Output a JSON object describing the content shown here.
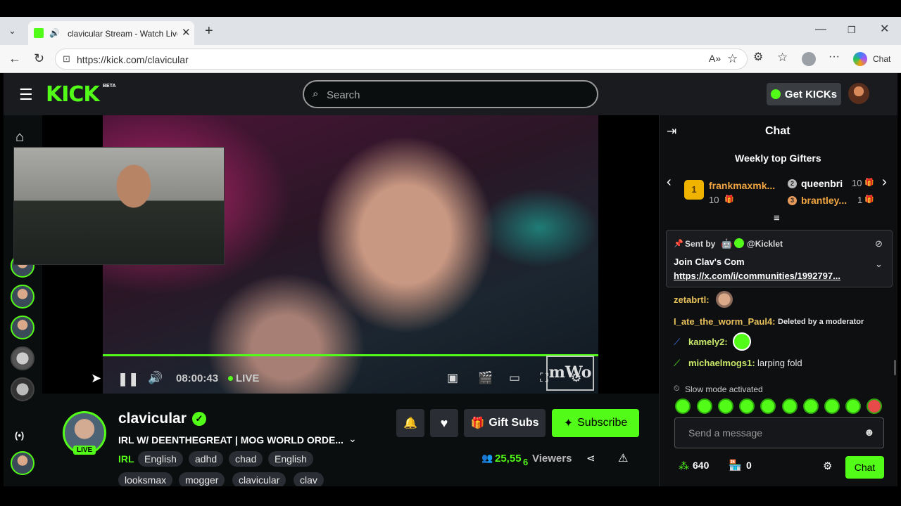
{
  "browser": {
    "tab_title": "clavicular Stream - Watch Live",
    "url": "https://kick.com/clavicular",
    "copilot_label": "Chat"
  },
  "topbar": {
    "logo": "KICK",
    "beta": "BETA",
    "search_placeholder": "Search",
    "get_kicks": "Get KICKs"
  },
  "player": {
    "time": "08:00:43",
    "live": "LIVE",
    "watermark": "mWo"
  },
  "stream": {
    "channel": "clavicular",
    "title": "IRL W/ DEENTHEGREAT | MOG WORLD ORDE...",
    "live_badge": "LIVE",
    "category": "IRL",
    "tags": [
      "English",
      "adhd",
      "chad",
      "English",
      "looksmax",
      "mogger",
      "clavicular",
      "clav"
    ],
    "viewers_value": "25,55",
    "viewers_digit": "6",
    "viewers_label": "Viewers",
    "gift_subs": "Gift Subs",
    "subscribe": "Subscribe"
  },
  "chat": {
    "title": "Chat",
    "gifters_title": "Weekly top Gifters",
    "gifters": [
      {
        "rank": "1",
        "name": "frankmaxmk...",
        "count": "10"
      },
      {
        "rank": "2",
        "name": "queenbri",
        "count": "10"
      },
      {
        "rank": "3",
        "name": "brantley...",
        "count": "1"
      }
    ],
    "pinned_sent_by": "Sent by",
    "pinned_user": "@Kicklet",
    "pinned_text": "Join Clav's Com",
    "pinned_link": "https://x.com/i/communities/1992797...",
    "messages": [
      {
        "user": "zetabrtl:",
        "text": "",
        "color": "#e8c15a"
      },
      {
        "user": "I_ate_the_worm_Paul4:",
        "text": "Deleted by a moderator",
        "color": "#e8c15a"
      },
      {
        "user": "kamely2:",
        "text": "",
        "color": "#c8e86a"
      },
      {
        "user": "michaelmogs1:",
        "text": "larping fold",
        "color": "#c8e86a"
      }
    ],
    "slow_mode": "Slow mode activated",
    "input_placeholder": "Send a message",
    "points": "640",
    "shop_count": "0",
    "chat_button": "Chat"
  },
  "colors": {
    "kick_green": "#53fc18",
    "background": "#0b0e0f",
    "topbar": "#191b1f"
  }
}
